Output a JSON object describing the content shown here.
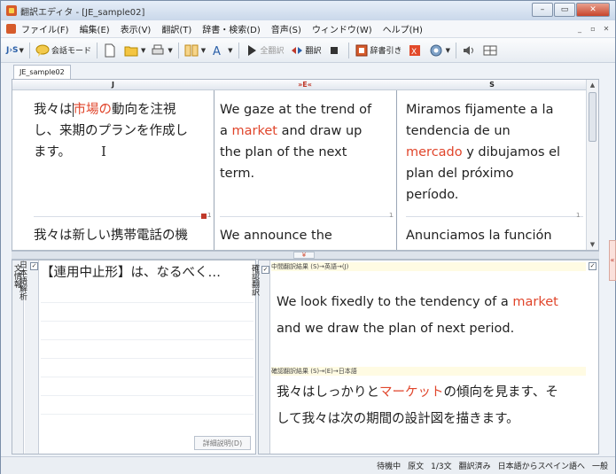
{
  "window": {
    "title": "翻訳エディタ - [JE_sample02]",
    "controls": {
      "min": "–",
      "max": "▭",
      "close": "✕"
    }
  },
  "menu": {
    "items": [
      "ファイル(F)",
      "編集(E)",
      "表示(V)",
      "翻訳(T)",
      "辞書・検索(D)",
      "音声(S)",
      "ウィンドウ(W)",
      "ヘルプ(H)"
    ],
    "mdi": {
      "min": "_",
      "restore": "▫",
      "close": "✕"
    }
  },
  "toolbar": {
    "lang_pair": "J›S",
    "conversation_mode": "会話モード",
    "translate_label": "全翻訳",
    "retranslate_label": "翻訳",
    "dict_lookup": "辞書引き"
  },
  "sheet_tab": "JE_sample02",
  "columns": {
    "j": "J",
    "e": "»E«",
    "s": "S"
  },
  "grid": {
    "row1": {
      "j_pre": "我々は",
      "j_hl": "市場の",
      "j_post1": "動向を注視",
      "j_line2": "し、来期のプランを作成し",
      "j_line3": "ます。",
      "cursor": "I",
      "e_line1": "We gaze at the trend of",
      "e_pre": "a ",
      "e_hl": "market",
      "e_post": " and draw up",
      "e_line3": "the plan of the next",
      "e_line4": "term.",
      "s_line1": "Miramos fijamente a la",
      "s_line2": "tendencia de un",
      "s_hl": "mercado",
      "s_post": " y dibujamos el",
      "s_line4": "plan del próximo",
      "s_line5": "período."
    },
    "row2": {
      "j": "我々は新しい携帯電話の機",
      "e": "We announce the",
      "s": "Anunciamos la función"
    },
    "badges": {
      "j": "1",
      "e": "1",
      "s": "1"
    }
  },
  "splitter_arrow": "¥",
  "side_marker": "«",
  "lower_left": {
    "tab1": "文情報",
    "tab2": "日本語解析",
    "check": "✓",
    "text": "【連用中止形】は、なるべく…",
    "detail_button": "詳細説明(D)"
  },
  "lower_right": {
    "tab": "確認翻訳",
    "label1": "中間翻訳結果 (S)→英語→(J)",
    "line1_pre": "We look fixedly to the tendency of a ",
    "line1_hl": "market",
    "line2": "and we draw the plan of next period.",
    "label2": "確認翻訳結果 (S)→(E)→日本語",
    "line3_pre": "我々はしっかりと",
    "line3_hl": "マーケット",
    "line3_post": "の傾向を見ます、そ",
    "line4": "して我々は次の期間の設計図を描きます。",
    "check": "✓"
  },
  "status": {
    "state": "待機中",
    "source": "原文",
    "position": "1/3文",
    "translated": "翻訳済み",
    "direction": "日本語からスペイン語へ",
    "category": "一般"
  },
  "colors": {
    "highlight": "#e0452b",
    "title_bg": "#c9d8ea",
    "close": "#c7442b"
  }
}
